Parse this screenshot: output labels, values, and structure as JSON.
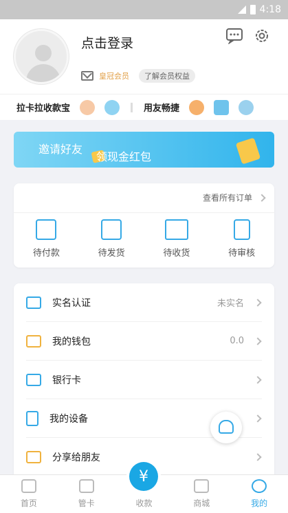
{
  "status": {
    "time": "4:18"
  },
  "profile": {
    "login_label": "点击登录",
    "member_label": "皇冠会员",
    "member_benefits": "了解会员权益"
  },
  "quickbar": {
    "group1": "拉卡拉收款宝",
    "group2": "用友畅捷"
  },
  "banner": {
    "line1": "邀请好友",
    "line2": "领现金红包"
  },
  "orders": {
    "view_all": "查看所有订单",
    "items": [
      {
        "label": "待付款",
        "icon": "wallet-icon"
      },
      {
        "label": "待发货",
        "icon": "box-icon"
      },
      {
        "label": "待收货",
        "icon": "truck-icon"
      },
      {
        "label": "待审核",
        "icon": "review-icon"
      }
    ]
  },
  "menu": {
    "items": [
      {
        "label": "实名认证",
        "value": "未实名",
        "icon": "id-card-icon"
      },
      {
        "label": "我的钱包",
        "value": "0.0",
        "icon": "wallet-icon"
      },
      {
        "label": "银行卡",
        "value": "",
        "icon": "bank-card-icon"
      },
      {
        "label": "我的设备",
        "value": "",
        "icon": "device-icon"
      },
      {
        "label": "分享给朋友",
        "value": "",
        "icon": "share-icon"
      }
    ]
  },
  "tabs": [
    {
      "label": "首页",
      "icon": "home-icon"
    },
    {
      "label": "管卡",
      "icon": "card-icon"
    },
    {
      "label": "收款",
      "icon": "yuan-icon"
    },
    {
      "label": "商城",
      "icon": "bag-icon"
    },
    {
      "label": "我的",
      "icon": "user-icon"
    }
  ],
  "fab_symbol": "¥",
  "colors": {
    "accent": "#35a9e6",
    "gold": "#e2a14a",
    "fab": "#1aa7e4"
  }
}
